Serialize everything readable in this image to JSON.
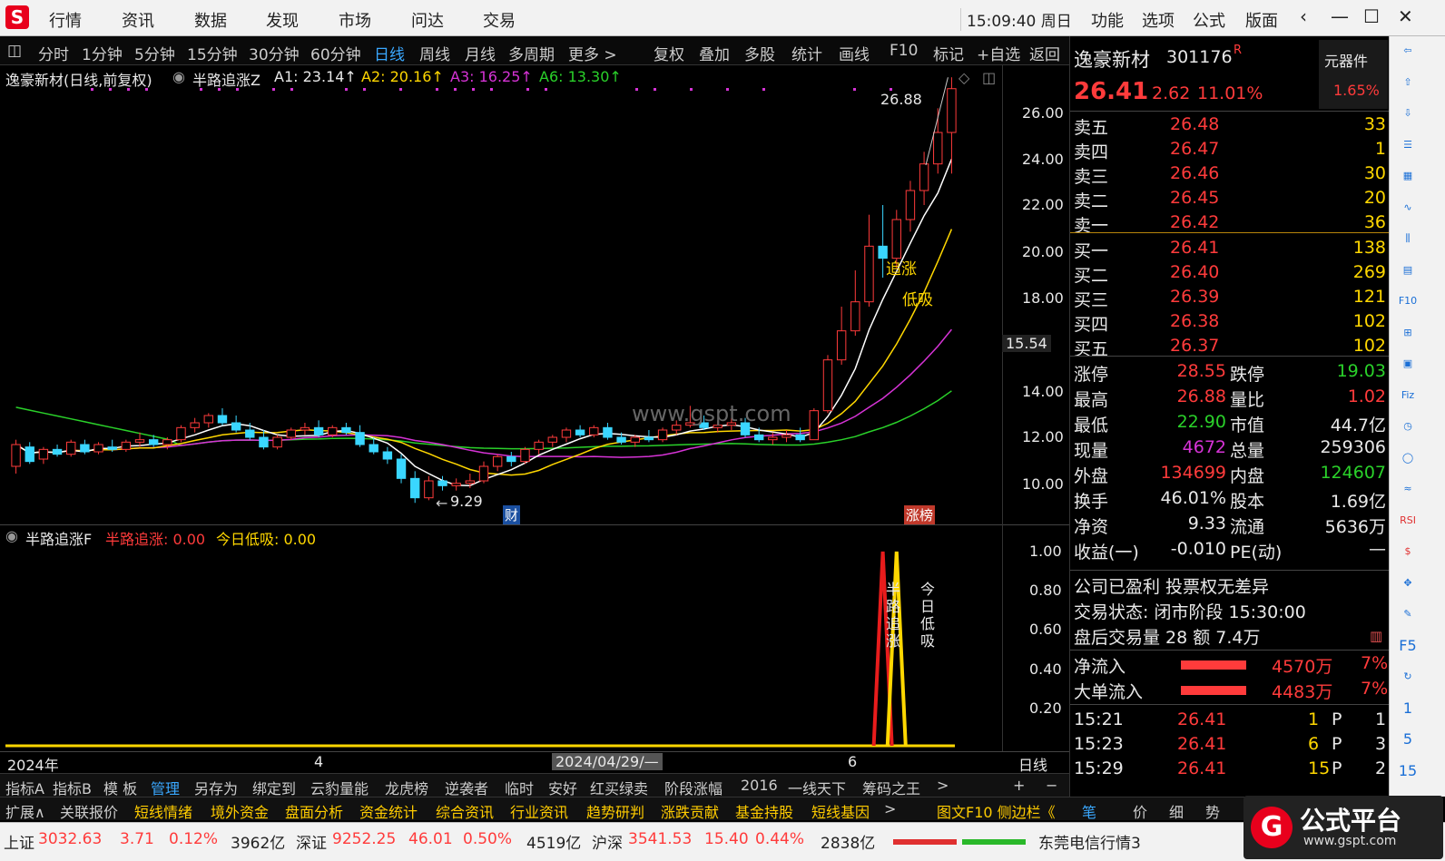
{
  "app": {
    "logo": "S",
    "menu": [
      "行情",
      "资讯",
      "数据",
      "发现",
      "市场",
      "问达",
      "交易"
    ],
    "clock": "15:09:40 周日",
    "right_menu": [
      "功能",
      "选项",
      "公式",
      "版面"
    ],
    "window_controls": [
      "‹",
      "—",
      "☐",
      "✕"
    ]
  },
  "toolbar": {
    "periods": [
      "分时",
      "1分钟",
      "5分钟",
      "15分钟",
      "30分钟",
      "60分钟",
      "日线",
      "周线",
      "月线",
      "多周期",
      "更多 >"
    ],
    "active": "日线",
    "tools": [
      "复权",
      "叠加",
      "多股",
      "统计",
      "画线",
      "F10",
      "标记",
      "+自选",
      "返回"
    ]
  },
  "main_chart": {
    "title": "逸豪新材(日线,前复权)",
    "indicator_name": "半路追涨Z",
    "a1": "A1: 23.14↑",
    "a2": "A2: 20.16↑",
    "a3": "A3: 16.25↑",
    "a6": "A6: 13.30↑",
    "high_label": "26.88",
    "low_label": "9.29",
    "price_marker": "15.54",
    "watermark": "www.gspt.com",
    "mark_cai": "财",
    "mark_zhangbang": "涨榜",
    "ann_zhuizhang": "追涨",
    "ann_dixi": "低吸",
    "y_ticks": [
      "26.00",
      "24.00",
      "22.00",
      "20.00",
      "18.00",
      "14.00",
      "12.00",
      "10.00"
    ]
  },
  "sub_chart": {
    "name": "半路追涨F",
    "v1": "半路追涨: 0.00",
    "v2": "今日低吸: 0.00",
    "y_ticks": [
      "1.00",
      "0.80",
      "0.60",
      "0.40",
      "0.20"
    ],
    "vlabel1": "半路追涨",
    "vlabel2": "今日低吸"
  },
  "x_axis": {
    "year": "2024年",
    "m4": "4",
    "cursor": "2024/04/29/—",
    "m6": "6",
    "period": "日线"
  },
  "quote": {
    "name": "逸豪新材",
    "code": "301176",
    "badge": "R",
    "sector": "元器件",
    "sector_pct": "1.65%",
    "price": "26.41",
    "change": "2.62",
    "pct": "11.01%",
    "asks": [
      {
        "label": "卖五",
        "price": "26.48",
        "vol": "33"
      },
      {
        "label": "卖四",
        "price": "26.47",
        "vol": "1"
      },
      {
        "label": "卖三",
        "price": "26.46",
        "vol": "30"
      },
      {
        "label": "卖二",
        "price": "26.45",
        "vol": "20"
      },
      {
        "label": "卖一",
        "price": "26.42",
        "vol": "36"
      }
    ],
    "bids": [
      {
        "label": "买一",
        "price": "26.41",
        "vol": "138"
      },
      {
        "label": "买二",
        "price": "26.40",
        "vol": "269"
      },
      {
        "label": "买三",
        "price": "26.39",
        "vol": "121"
      },
      {
        "label": "买四",
        "price": "26.38",
        "vol": "102"
      },
      {
        "label": "买五",
        "price": "26.37",
        "vol": "102"
      }
    ],
    "stats": [
      {
        "k1": "涨停",
        "v1": "28.55",
        "k2": "跌停",
        "v2": "19.03",
        "c1": "red",
        "c2": "green"
      },
      {
        "k1": "最高",
        "v1": "26.88",
        "k2": "量比",
        "v2": "1.02",
        "c1": "red",
        "c2": "red"
      },
      {
        "k1": "最低",
        "v1": "22.90",
        "k2": "市值",
        "v2": "44.7亿",
        "c1": "green",
        "c2": "white"
      },
      {
        "k1": "现量",
        "v1": "4672",
        "k2": "总量",
        "v2": "259306",
        "c1": "magenta",
        "c2": "white"
      },
      {
        "k1": "外盘",
        "v1": "134699",
        "k2": "内盘",
        "v2": "124607",
        "c1": "red",
        "c2": "green"
      },
      {
        "k1": "换手",
        "v1": "46.01%",
        "k2": "股本",
        "v2": "1.69亿",
        "c1": "white",
        "c2": "white"
      },
      {
        "k1": "净资",
        "v1": "9.33",
        "k2": "流通",
        "v2": "5636万",
        "c1": "white",
        "c2": "white"
      },
      {
        "k1": "收益(一)",
        "v1": "-0.010",
        "k2": "PE(动)",
        "v2": "—",
        "c1": "white",
        "c2": "white"
      }
    ],
    "note1": "公司已盈利 投票权无差异",
    "note2": "交易状态: 闭市阶段 15:30:00",
    "note3": "盘后交易量 28 额 7.4万",
    "net_inflow_label": "净流入",
    "net_inflow_val": "4570万",
    "net_inflow_pct": "7%",
    "big_inflow_label": "大单流入",
    "big_inflow_val": "4483万",
    "big_inflow_pct": "7%",
    "ticks": [
      {
        "time": "15:21",
        "price": "26.41",
        "vol": "1",
        "side": "P",
        "n": "1"
      },
      {
        "time": "15:23",
        "price": "26.41",
        "vol": "6",
        "side": "P",
        "n": "3"
      },
      {
        "time": "15:29",
        "price": "26.41",
        "vol": "15",
        "side": "P",
        "n": "2"
      }
    ],
    "bottom_tabs": [
      "笔",
      "价",
      "细",
      "势"
    ]
  },
  "tabs1": [
    "指标A",
    "指标B",
    "模 板",
    "管理",
    "另存为",
    "绑定到",
    "云豹量能",
    "龙虎榜",
    "逆袭者",
    "临时",
    "安好",
    "红买绿卖",
    "阶段涨幅",
    "2016",
    "一线天下",
    "筹码之王",
    ">"
  ],
  "tabs1_right": [
    "+",
    "−"
  ],
  "tabs2": [
    "扩展∧",
    "关联报价",
    "短线情绪",
    "境外资金",
    "盘面分析",
    "资金统计",
    "综合资讯",
    "行业资讯",
    "趋势研判",
    "涨跌贡献",
    "基金持股",
    "短线基因",
    ">"
  ],
  "tabs2_right": "图文F10 侧边栏《",
  "status": {
    "sh_label": "上证",
    "sh_val": "3032.63",
    "sh_chg": "3.71",
    "sh_pct": "0.12%",
    "sh_amt": "3962亿",
    "sz_label": "深证",
    "sz_val": "9252.25",
    "sz_chg": "46.01",
    "sz_pct": "0.50%",
    "sz_amt": "4519亿",
    "hs_label": "沪深",
    "hs_val": "3541.53",
    "hs_chg": "15.40",
    "hs_pct": "0.44%",
    "hs_amt": "2838亿",
    "feed": "东莞电信行情3",
    "brand": "公式平台",
    "brand_url": "www.gspt.com"
  },
  "sidebar_icons": [
    "back-arrow",
    "up-arrow",
    "down-arrow",
    "list",
    "grid",
    "line-chart",
    "candle",
    "doc",
    "F10",
    "tree",
    "doc2",
    "F12",
    "clock",
    "ring",
    "wave",
    "RSI",
    "dollar",
    "move",
    "pencil",
    "F5",
    "refresh",
    "1",
    "5",
    "15"
  ],
  "chart_data": {
    "type": "candlestick",
    "note_colors": {
      "up": "#ff3b3b",
      "down": "#3ad6ff",
      "ma1": "#ffffff",
      "ma2": "#ffd700",
      "ma3": "#d633d6",
      "ma4": "#2ad12a"
    },
    "ohlc": [
      [
        10.8,
        11.9,
        10.5,
        11.7
      ],
      [
        11.6,
        11.8,
        10.9,
        11.0
      ],
      [
        11.1,
        11.6,
        10.9,
        11.5
      ],
      [
        11.5,
        11.7,
        11.2,
        11.3
      ],
      [
        11.3,
        11.9,
        11.2,
        11.8
      ],
      [
        11.7,
        11.9,
        11.3,
        11.4
      ],
      [
        11.4,
        11.8,
        11.3,
        11.7
      ],
      [
        11.6,
        11.9,
        11.4,
        11.5
      ],
      [
        11.5,
        11.9,
        11.4,
        11.8
      ],
      [
        11.8,
        12.2,
        11.6,
        11.9
      ],
      [
        11.9,
        12.1,
        11.6,
        11.7
      ],
      [
        11.7,
        12.0,
        11.5,
        11.9
      ],
      [
        11.9,
        12.5,
        11.8,
        12.4
      ],
      [
        12.4,
        12.8,
        12.2,
        12.6
      ],
      [
        12.6,
        13.0,
        12.4,
        12.9
      ],
      [
        12.9,
        13.2,
        12.5,
        12.6
      ],
      [
        12.6,
        12.9,
        12.2,
        12.3
      ],
      [
        12.3,
        12.6,
        11.9,
        12.0
      ],
      [
        12.0,
        12.3,
        11.5,
        11.6
      ],
      [
        11.6,
        12.1,
        11.5,
        12.0
      ],
      [
        12.0,
        12.4,
        11.9,
        12.3
      ],
      [
        12.3,
        12.6,
        12.1,
        12.4
      ],
      [
        12.4,
        12.7,
        12.0,
        12.1
      ],
      [
        12.1,
        12.5,
        12.0,
        12.4
      ],
      [
        12.4,
        12.6,
        12.1,
        12.2
      ],
      [
        12.2,
        12.5,
        11.6,
        11.7
      ],
      [
        11.7,
        12.0,
        11.3,
        11.4
      ],
      [
        11.4,
        11.6,
        10.9,
        11.1
      ],
      [
        11.1,
        11.3,
        10.1,
        10.3
      ],
      [
        10.3,
        10.6,
        9.29,
        9.5
      ],
      [
        9.5,
        10.4,
        9.4,
        10.2
      ],
      [
        10.2,
        10.4,
        9.8,
        10.0
      ],
      [
        10.0,
        10.3,
        9.8,
        10.1
      ],
      [
        10.1,
        10.5,
        9.9,
        10.2
      ],
      [
        10.2,
        11.0,
        10.1,
        10.8
      ],
      [
        10.8,
        11.3,
        10.6,
        11.2
      ],
      [
        11.2,
        11.4,
        10.8,
        11.0
      ],
      [
        11.0,
        11.6,
        10.9,
        11.5
      ],
      [
        11.5,
        11.9,
        11.3,
        11.8
      ],
      [
        11.8,
        12.1,
        11.6,
        12.0
      ],
      [
        12.0,
        12.4,
        11.8,
        12.3
      ],
      [
        12.3,
        12.5,
        12.0,
        12.1
      ],
      [
        12.1,
        12.5,
        12.0,
        12.4
      ],
      [
        12.4,
        12.6,
        11.9,
        12.0
      ],
      [
        12.0,
        12.2,
        11.7,
        11.8
      ],
      [
        11.8,
        12.1,
        11.6,
        12.0
      ],
      [
        12.0,
        12.3,
        11.8,
        11.9
      ],
      [
        11.9,
        12.4,
        11.8,
        12.3
      ],
      [
        12.3,
        12.7,
        12.1,
        12.5
      ],
      [
        12.5,
        13.3,
        12.4,
        12.6
      ],
      [
        12.6,
        12.9,
        12.3,
        12.4
      ],
      [
        12.4,
        12.7,
        12.2,
        12.5
      ],
      [
        12.5,
        12.8,
        12.3,
        12.6
      ],
      [
        12.6,
        12.8,
        12.0,
        12.1
      ],
      [
        12.1,
        12.4,
        11.8,
        11.9
      ],
      [
        11.9,
        12.2,
        11.7,
        12.0
      ],
      [
        12.0,
        12.3,
        11.8,
        12.1
      ],
      [
        12.1,
        12.4,
        11.8,
        11.9
      ],
      [
        11.9,
        13.2,
        11.9,
        13.1
      ],
      [
        13.1,
        15.4,
        13.0,
        15.2
      ],
      [
        15.2,
        17.4,
        15.0,
        16.4
      ],
      [
        16.4,
        18.9,
        16.2,
        17.6
      ],
      [
        17.6,
        21.2,
        17.4,
        19.9
      ],
      [
        19.9,
        21.6,
        18.6,
        19.4
      ],
      [
        19.4,
        21.4,
        19.0,
        21.0
      ],
      [
        21.0,
        22.6,
        20.5,
        22.2
      ],
      [
        22.2,
        23.8,
        21.6,
        23.3
      ],
      [
        23.3,
        25.6,
        22.9,
        24.6
      ],
      [
        24.6,
        26.88,
        22.9,
        26.41
      ]
    ],
    "sub_signals": {
      "zhuizhang_index": 63,
      "dixi_index": 64,
      "peak": 1.0
    },
    "y_range": [
      9.0,
      27.0
    ]
  }
}
